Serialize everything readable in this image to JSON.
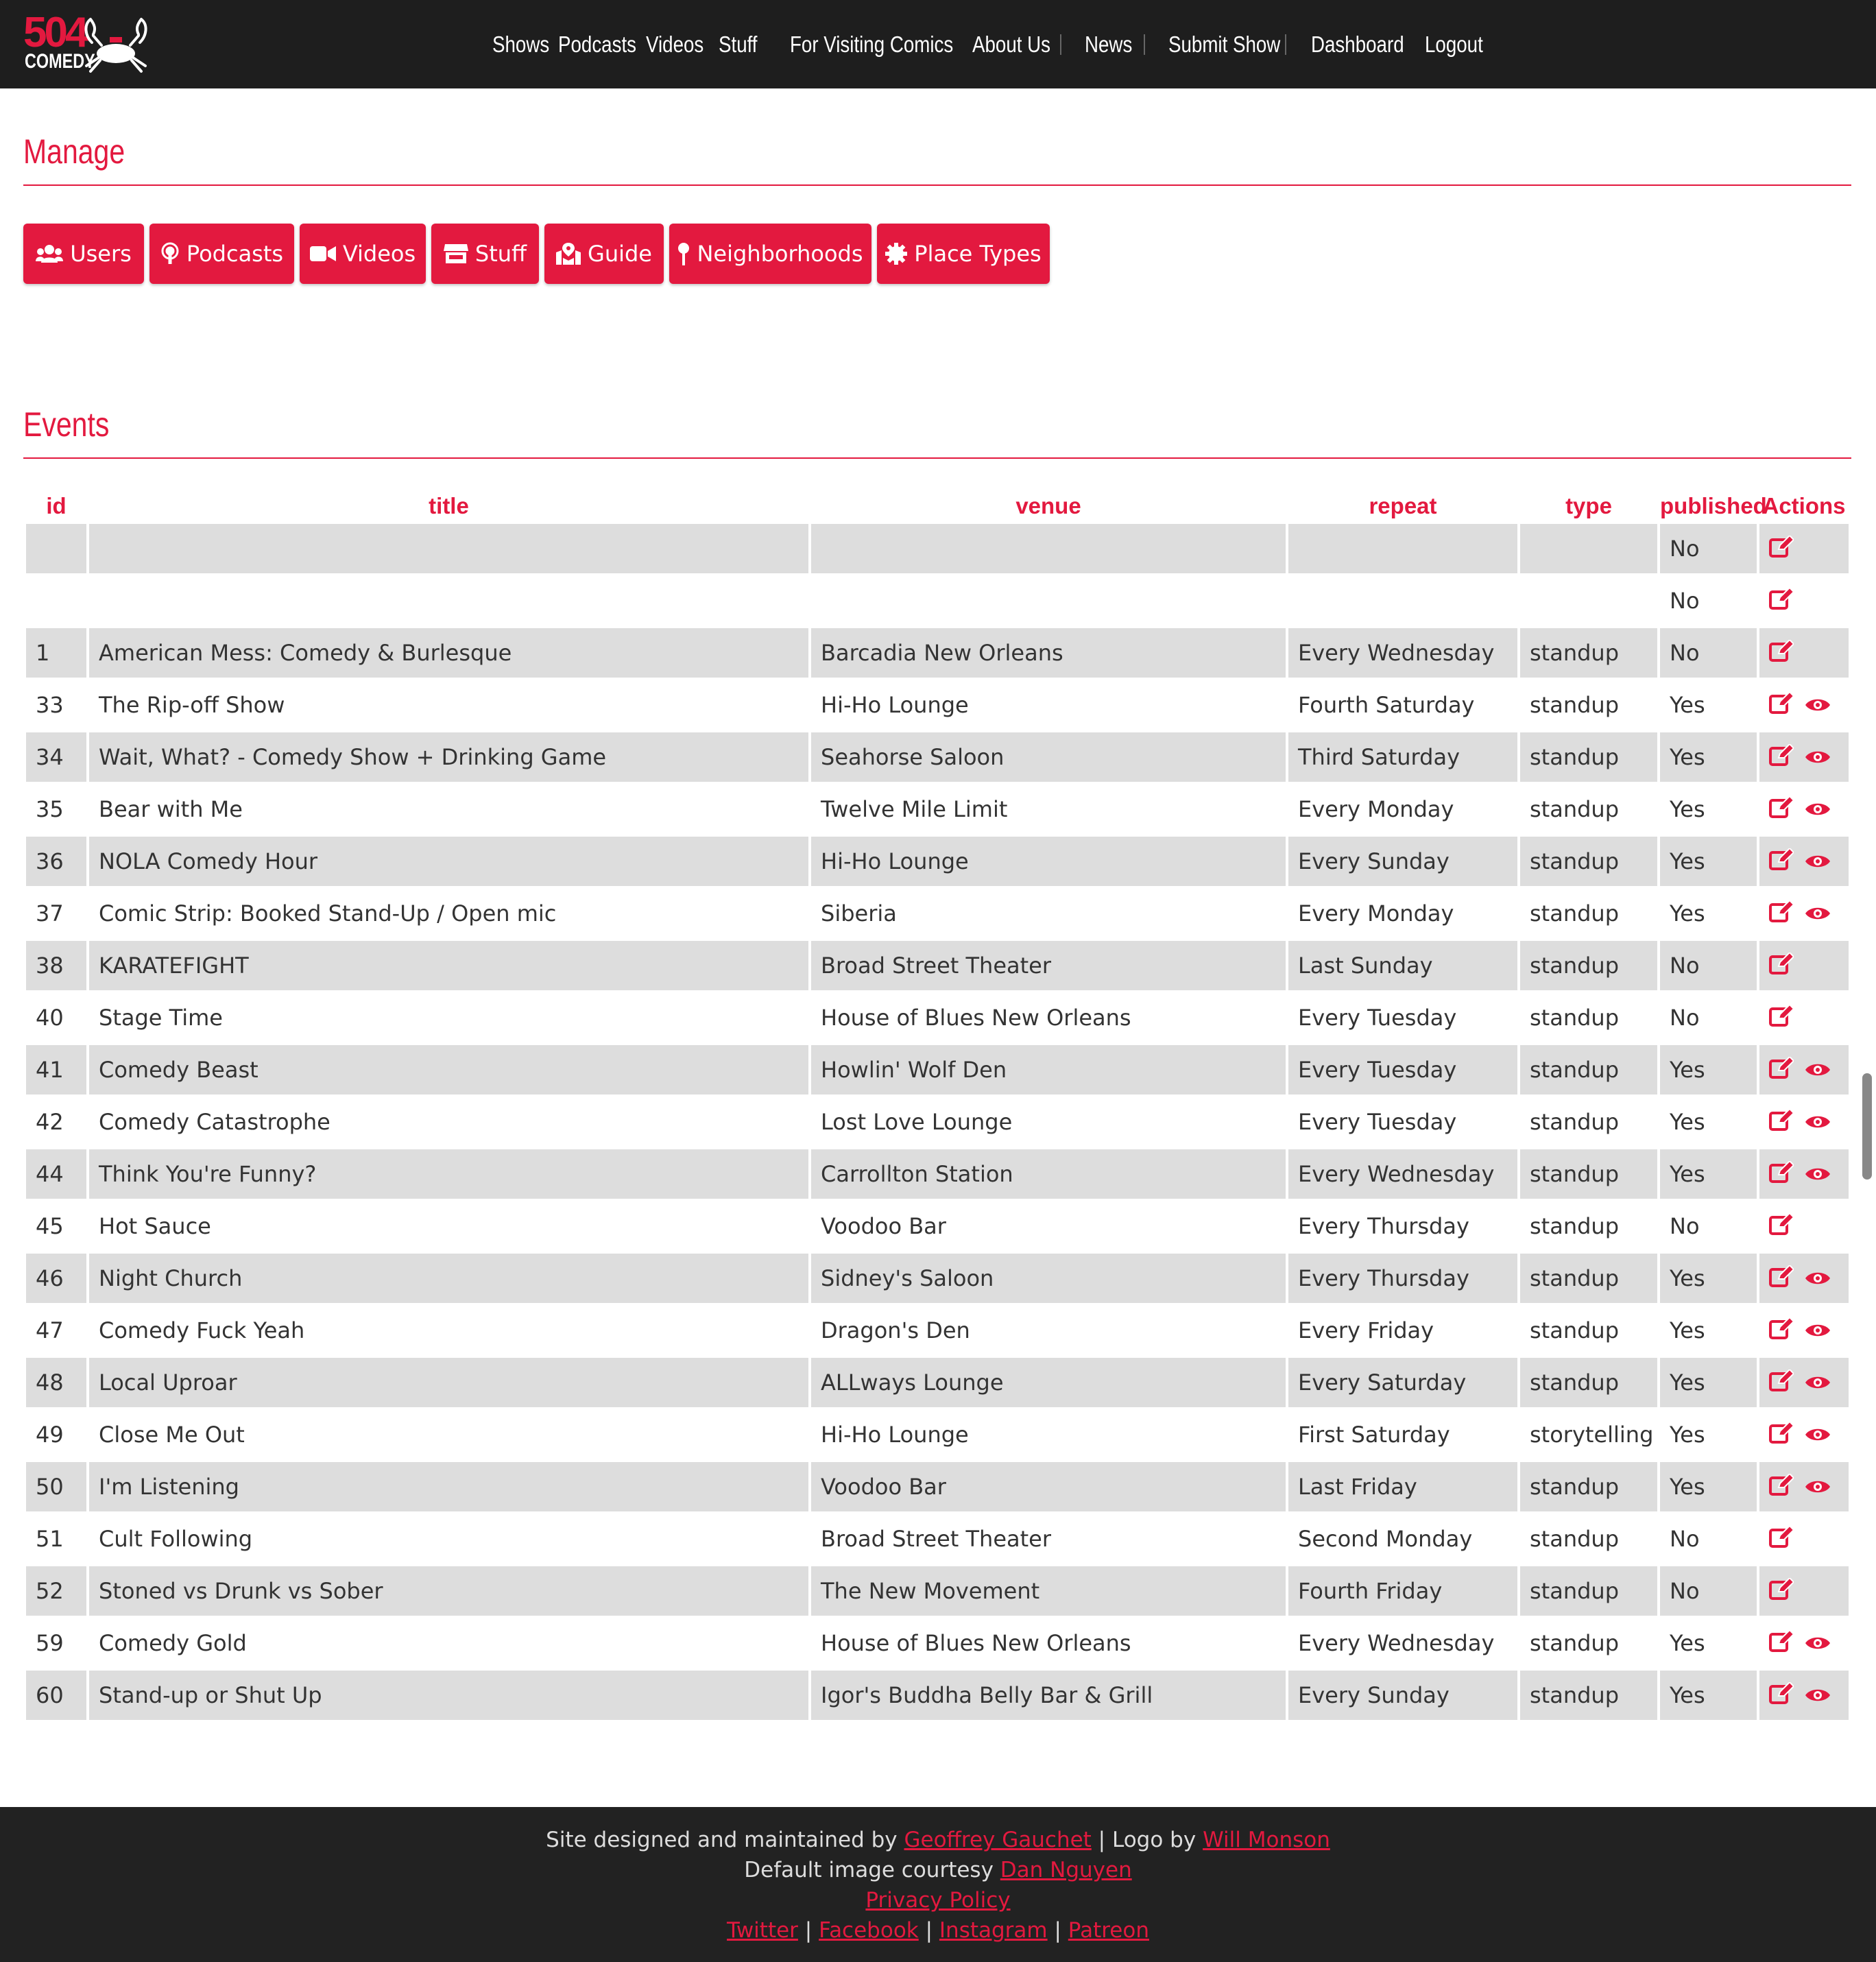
{
  "brand": {
    "logo_number": "504",
    "logo_word": "COMEDY"
  },
  "nav": [
    {
      "label": "Shows"
    },
    {
      "label": "Podcasts"
    },
    {
      "label": "Videos"
    },
    {
      "label": "Stuff"
    },
    {
      "label": "For Visiting Comics"
    },
    {
      "label": "About Us"
    },
    {
      "label": "News"
    },
    {
      "label": "Submit Show"
    },
    {
      "label": "Dashboard"
    },
    {
      "label": "Logout"
    }
  ],
  "manage": {
    "title": "Manage",
    "buttons": [
      {
        "label": "Users",
        "icon": "users-icon"
      },
      {
        "label": "Podcasts",
        "icon": "podcast-icon"
      },
      {
        "label": "Videos",
        "icon": "video-icon"
      },
      {
        "label": "Stuff",
        "icon": "store-icon"
      },
      {
        "label": "Guide",
        "icon": "map-icon"
      },
      {
        "label": "Neighborhoods",
        "icon": "map-pin-icon"
      },
      {
        "label": "Place Types",
        "icon": "gear-icon"
      }
    ]
  },
  "events": {
    "title": "Events",
    "columns": [
      "id",
      "title",
      "venue",
      "repeat",
      "type",
      "published",
      "Actions"
    ],
    "rows": [
      {
        "id": "",
        "title": "",
        "venue": "",
        "repeat": "",
        "type": "",
        "published": "No",
        "view": false
      },
      {
        "id": "",
        "title": "",
        "venue": "",
        "repeat": "",
        "type": "",
        "published": "No",
        "view": false
      },
      {
        "id": "1",
        "title": "American Mess: Comedy & Burlesque",
        "venue": "Barcadia New Orleans",
        "repeat": "Every Wednesday",
        "type": "standup",
        "published": "No",
        "view": false
      },
      {
        "id": "33",
        "title": "The Rip-off Show",
        "venue": "Hi-Ho Lounge",
        "repeat": "Fourth Saturday",
        "type": "standup",
        "published": "Yes",
        "view": true
      },
      {
        "id": "34",
        "title": "Wait, What? - Comedy Show + Drinking Game",
        "venue": "Seahorse Saloon",
        "repeat": "Third Saturday",
        "type": "standup",
        "published": "Yes",
        "view": true
      },
      {
        "id": "35",
        "title": "Bear with Me",
        "venue": "Twelve Mile Limit",
        "repeat": "Every Monday",
        "type": "standup",
        "published": "Yes",
        "view": true
      },
      {
        "id": "36",
        "title": "NOLA Comedy Hour",
        "venue": "Hi-Ho Lounge",
        "repeat": "Every Sunday",
        "type": "standup",
        "published": "Yes",
        "view": true
      },
      {
        "id": "37",
        "title": "Comic Strip: Booked Stand-Up / Open mic",
        "venue": "Siberia",
        "repeat": "Every Monday",
        "type": "standup",
        "published": "Yes",
        "view": true
      },
      {
        "id": "38",
        "title": "KARATEFIGHT",
        "venue": "Broad Street Theater",
        "repeat": "Last Sunday",
        "type": "standup",
        "published": "No",
        "view": false
      },
      {
        "id": "40",
        "title": "Stage Time",
        "venue": "House of Blues New Orleans",
        "repeat": "Every Tuesday",
        "type": "standup",
        "published": "No",
        "view": false
      },
      {
        "id": "41",
        "title": "Comedy Beast",
        "venue": "Howlin' Wolf Den",
        "repeat": "Every Tuesday",
        "type": "standup",
        "published": "Yes",
        "view": true
      },
      {
        "id": "42",
        "title": "Comedy Catastrophe",
        "venue": "Lost Love Lounge",
        "repeat": "Every Tuesday",
        "type": "standup",
        "published": "Yes",
        "view": true
      },
      {
        "id": "44",
        "title": "Think You're Funny?",
        "venue": "Carrollton Station",
        "repeat": "Every Wednesday",
        "type": "standup",
        "published": "Yes",
        "view": true
      },
      {
        "id": "45",
        "title": "Hot Sauce",
        "venue": "Voodoo Bar",
        "repeat": "Every Thursday",
        "type": "standup",
        "published": "No",
        "view": false
      },
      {
        "id": "46",
        "title": "Night Church",
        "venue": "Sidney's Saloon",
        "repeat": "Every Thursday",
        "type": "standup",
        "published": "Yes",
        "view": true
      },
      {
        "id": "47",
        "title": "Comedy Fuck Yeah",
        "venue": "Dragon's Den",
        "repeat": "Every Friday",
        "type": "standup",
        "published": "Yes",
        "view": true
      },
      {
        "id": "48",
        "title": "Local Uproar",
        "venue": "ALLways Lounge",
        "repeat": "Every Saturday",
        "type": "standup",
        "published": "Yes",
        "view": true
      },
      {
        "id": "49",
        "title": "Close Me Out",
        "venue": "Hi-Ho Lounge",
        "repeat": "First Saturday",
        "type": "storytelling",
        "published": "Yes",
        "view": true
      },
      {
        "id": "50",
        "title": "I'm Listening",
        "venue": "Voodoo Bar",
        "repeat": "Last Friday",
        "type": "standup",
        "published": "Yes",
        "view": true
      },
      {
        "id": "51",
        "title": "Cult Following",
        "venue": "Broad Street Theater",
        "repeat": "Second Monday",
        "type": "standup",
        "published": "No",
        "view": false
      },
      {
        "id": "52",
        "title": "Stoned vs Drunk vs Sober",
        "venue": "The New Movement",
        "repeat": "Fourth Friday",
        "type": "standup",
        "published": "No",
        "view": false
      },
      {
        "id": "59",
        "title": "Comedy Gold",
        "venue": "House of Blues New Orleans",
        "repeat": "Every Wednesday",
        "type": "standup",
        "published": "Yes",
        "view": true
      },
      {
        "id": "60",
        "title": "Stand-up or Shut Up",
        "venue": "Igor's Buddha Belly Bar & Grill",
        "repeat": "Every Sunday",
        "type": "standup",
        "published": "Yes",
        "view": true
      }
    ]
  },
  "footer": {
    "designed_prefix": "Site designed and maintained by ",
    "designer": "Geoffrey Gauchet",
    "logo_prefix": " | Logo by ",
    "logo_artist": "Will Monson",
    "image_prefix": "Default image courtesy ",
    "image_credit": "Dan Nguyen",
    "privacy": "Privacy Policy",
    "social": [
      "Twitter",
      "Facebook",
      "Instagram",
      "Patreon"
    ],
    "social_sep": " | "
  },
  "colors": {
    "accent": "#e3193f",
    "topbar": "#1e1e1e",
    "footer": "#222222",
    "row_alt": "#dddddd"
  }
}
